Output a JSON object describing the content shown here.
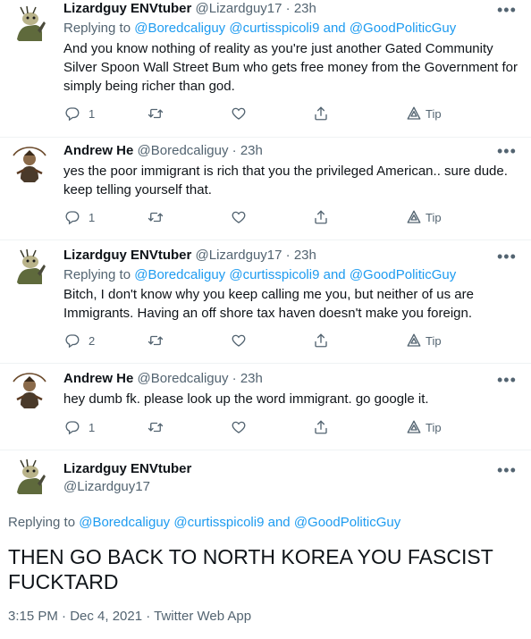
{
  "colors": {
    "link": "#1d9bf0",
    "muted": "#536471",
    "text": "#0f1419"
  },
  "tweets": [
    {
      "name": "Lizardguy ENVtuber",
      "handle": "@Lizardguy17",
      "sep": "·",
      "time": "23h",
      "reply_prefix": "Replying to",
      "reply_to": [
        "@Boredcaliguy",
        "@curtisspicoli9",
        "and",
        "@GoodPoliticGuy"
      ],
      "text": "And you know nothing of reality as you're just another Gated Community Silver Spoon Wall Street Bum who gets free money from the Government for simply being richer than god.",
      "reply_count": "1",
      "tip_label": "Tip"
    },
    {
      "name": "Andrew He",
      "handle": "@Boredcaliguy",
      "sep": "·",
      "time": "23h",
      "text": "yes  the poor immigrant is rich that you the privileged American..  sure dude.  keep telling yourself that.",
      "reply_count": "1",
      "tip_label": "Tip"
    },
    {
      "name": "Lizardguy ENVtuber",
      "handle": "@Lizardguy17",
      "sep": "·",
      "time": "23h",
      "reply_prefix": "Replying to",
      "reply_to": [
        "@Boredcaliguy",
        "@curtisspicoli9",
        "and",
        "@GoodPoliticGuy"
      ],
      "text": "Bitch, I don't know why you keep calling me you, but neither of us are Immigrants. Having an off shore tax haven doesn't make you foreign.",
      "reply_count": "2",
      "tip_label": "Tip"
    },
    {
      "name": "Andrew He",
      "handle": "@Boredcaliguy",
      "sep": "·",
      "time": "23h",
      "text": "hey dumb fk.  please look up the word immigrant.  go google it.",
      "reply_count": "1",
      "tip_label": "Tip"
    }
  ],
  "main": {
    "name": "Lizardguy ENVtuber",
    "handle": "@Lizardguy17",
    "reply_prefix": "Replying to",
    "reply_to": [
      "@Boredcaliguy",
      "@curtisspicoli9",
      "and",
      "@GoodPoliticGuy"
    ],
    "text": "THEN GO BACK TO NORTH KOREA YOU FASCIST FUCKTARD",
    "meta": "3:15 PM · Dec 4, 2021 · Twitter Web App"
  }
}
